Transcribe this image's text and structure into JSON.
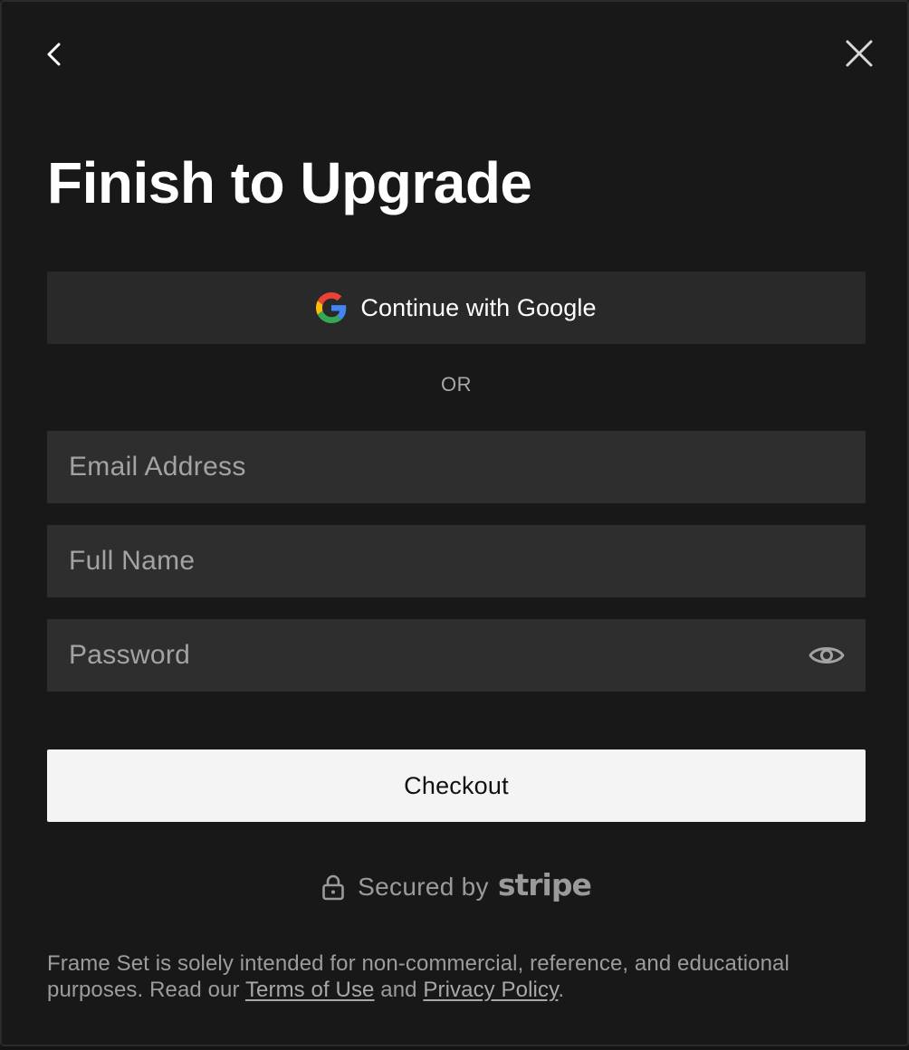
{
  "header": {
    "back_icon": "chevron-left-icon",
    "close_icon": "close-icon"
  },
  "title": "Finish to Upgrade",
  "google": {
    "label": "Continue with Google",
    "icon": "google-icon"
  },
  "divider_text": "OR",
  "fields": {
    "email": {
      "value": "",
      "placeholder": "Email Address"
    },
    "full_name": {
      "value": "",
      "placeholder": "Full Name"
    },
    "password": {
      "value": "",
      "placeholder": "Password",
      "toggle_icon": "eye-icon"
    }
  },
  "checkout_label": "Checkout",
  "secured": {
    "lock_icon": "lock-icon",
    "text": "Secured by",
    "brand": "stripe"
  },
  "footer": {
    "text_before": "Frame Set is solely intended for non-commercial, reference, and educational purposes. Read our ",
    "terms_link": "Terms of Use",
    "text_middle": " and ",
    "privacy_link": "Privacy Policy",
    "text_after": "."
  },
  "colors": {
    "background": "#181818",
    "field_background": "#2e2e2e",
    "button_background": "#292929",
    "primary_button": "#f4f4f4",
    "muted_text": "#9c9c9c"
  }
}
